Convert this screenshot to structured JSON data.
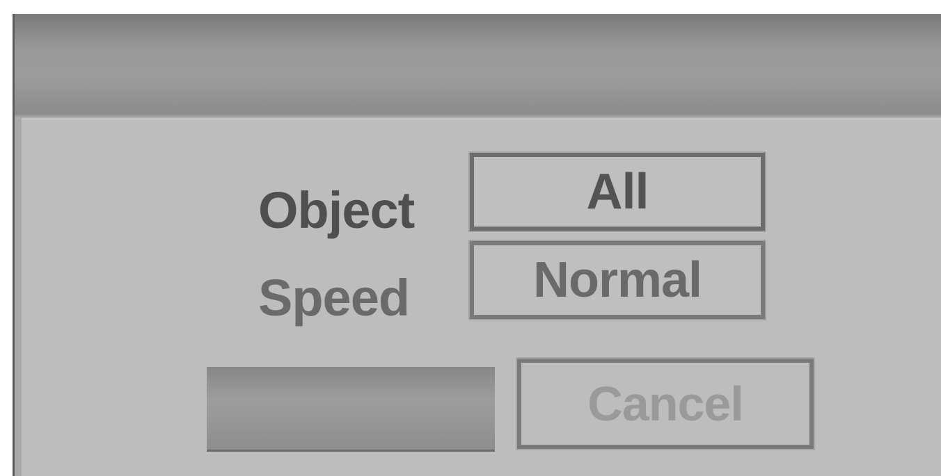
{
  "dialog": {
    "fields": [
      {
        "label": "Object",
        "value": "All"
      },
      {
        "label": "Speed",
        "value": "Normal"
      }
    ],
    "buttons": {
      "ok_label": "",
      "cancel_label": "Cancel"
    }
  },
  "colors": {
    "panel_background": "#bdbdbd",
    "title_bar": "#9a9a9a",
    "field_border": "#6c6c6c",
    "label_text": "#555555",
    "selected_button": "#8d8d8d",
    "disabled_text": "#9a9a9a"
  }
}
